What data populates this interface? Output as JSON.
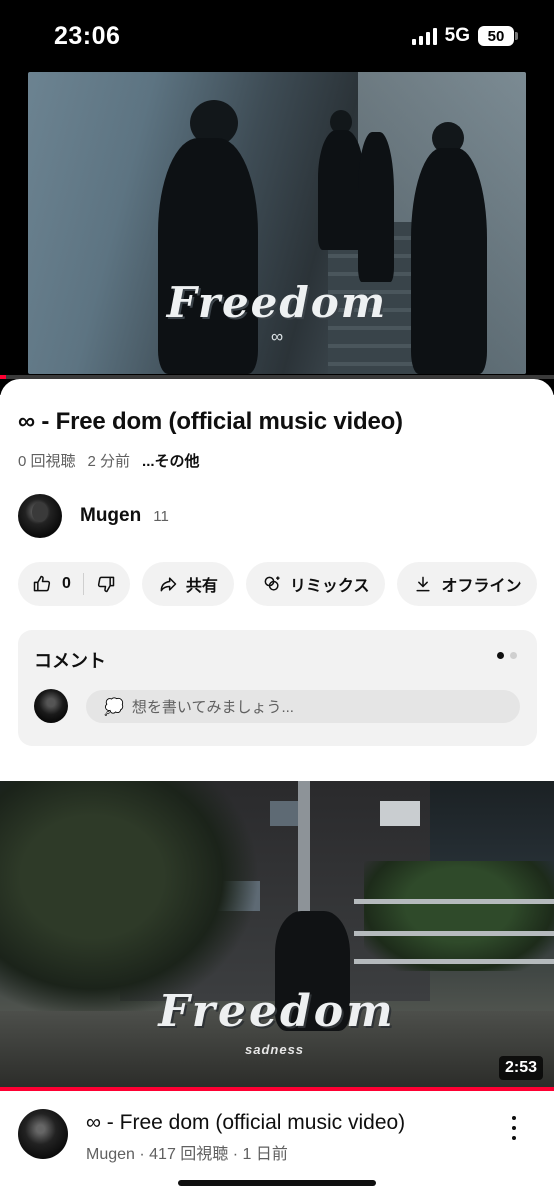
{
  "status_bar": {
    "time": "23:06",
    "network": "5G",
    "battery": "50"
  },
  "player": {
    "logo_text": "Freedom",
    "logo_symbol": "∞",
    "progress_fraction": 0.01,
    "accent_color": "#ff0033"
  },
  "video": {
    "title": "∞ - Free dom (official music video)",
    "views": "0 回視聴",
    "age": "2 分前",
    "more": "...その他"
  },
  "channel": {
    "name": "Mugen",
    "subscribers": "11"
  },
  "actions": {
    "like_count": "0",
    "share": "共有",
    "remix": "リミックス",
    "offline": "オフライン"
  },
  "comments": {
    "title": "コメント",
    "placeholder": "想を書いてみましょう...",
    "placeholder_icon": "💭"
  },
  "next_video": {
    "logo_text": "Freedom",
    "brand": "sadness",
    "duration": "2:53",
    "title": "∞ - Free dom (official music video)",
    "subtitle": "Mugen · 417 回視聴 · 1 日前"
  }
}
